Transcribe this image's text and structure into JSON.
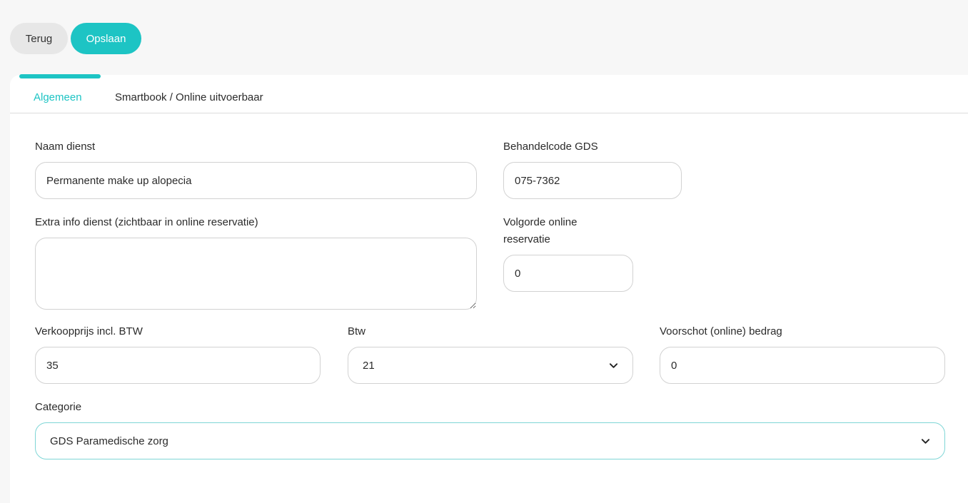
{
  "toolbar": {
    "back_label": "Terug",
    "save_label": "Opslaan"
  },
  "tabs": [
    {
      "label": "Algemeen",
      "active": true
    },
    {
      "label": "Smartbook / Online uitvoerbaar",
      "active": false
    }
  ],
  "form": {
    "service_name": {
      "label": "Naam dienst",
      "value": "Permanente make up alopecia"
    },
    "gds_code": {
      "label": "Behandelcode GDS",
      "value": "075-7362"
    },
    "extra_info": {
      "label": "Extra info dienst (zichtbaar in online reservatie)",
      "value": ""
    },
    "online_order": {
      "label_line1": "Volgorde online",
      "label_line2": "reservatie",
      "value": "0"
    },
    "price": {
      "label": "Verkoopprijs incl. BTW",
      "value": "35"
    },
    "vat": {
      "label": "Btw",
      "value": "21"
    },
    "deposit": {
      "label": "Voorschot (online) bedrag",
      "value": "0"
    },
    "category": {
      "label": "Categorie",
      "value": "GDS Paramedische zorg"
    }
  },
  "colors": {
    "accent": "#1dc4c4",
    "back_button_bg": "#e7e7e7",
    "page_bg": "#f7f7f7"
  },
  "icons": {
    "select_chevron": "chevron-down-icon"
  }
}
